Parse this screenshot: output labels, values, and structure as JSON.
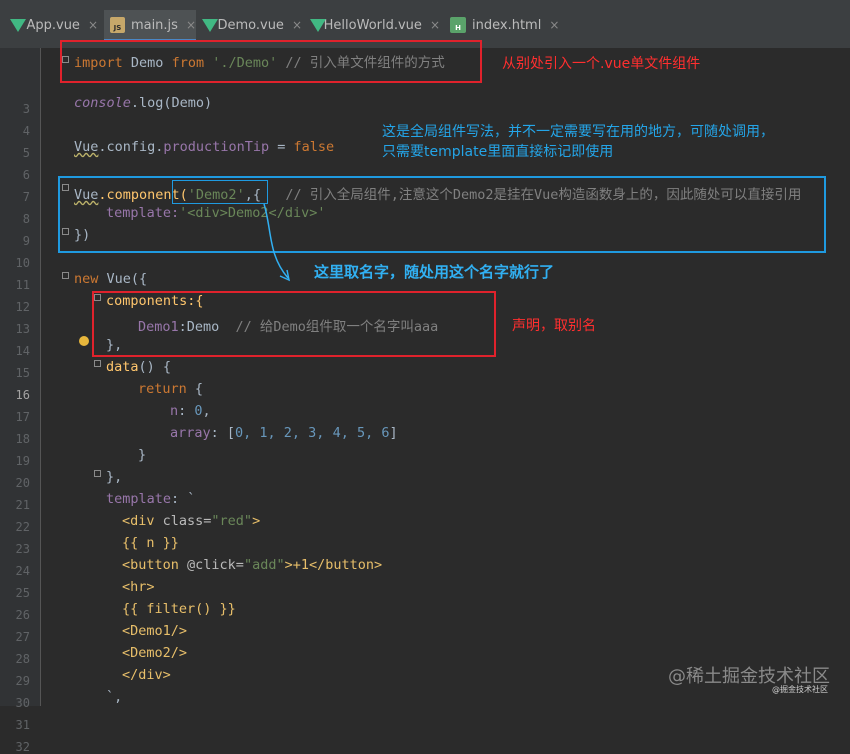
{
  "tabs": [
    {
      "label": "App.vue",
      "icon": "vue-icon",
      "active": false
    },
    {
      "label": "main.js",
      "icon": "js-file-icon",
      "active": true
    },
    {
      "label": "Demo.vue",
      "icon": "vue-icon",
      "active": false
    },
    {
      "label": "HelloWorld.vue",
      "icon": "vue-icon",
      "active": false
    },
    {
      "label": "index.html",
      "icon": "html-file-icon",
      "active": false
    }
  ],
  "tab_close_glyph": "×",
  "js_badge": "JS",
  "html_badge": "H",
  "line_numbers": [
    "3",
    "4",
    "5",
    "6",
    "7",
    "8",
    "9",
    "10",
    "11",
    "12",
    "13",
    "14",
    "15",
    "16",
    "17",
    "18",
    "19",
    "20",
    "21",
    "22",
    "23",
    "24",
    "25",
    "26",
    "27",
    "28",
    "29",
    "30",
    "31",
    "32"
  ],
  "current_line": "16",
  "code": {
    "l3_import": "import",
    "l3_demo": " Demo ",
    "l3_from": "from",
    "l3_path": " './Demo'",
    "l3_comment": " // 引入单文件组件的方式",
    "l5_console": "console",
    "l5_rest": ".log(Demo)",
    "l7_vue": "Vue",
    "l7_config": ".config.",
    "l7_tip": "productionTip",
    "l7_eq": " = ",
    "l7_false": "false",
    "l9_vue": "Vue",
    "l9_component": ".component(",
    "l9_name": "'Demo2'",
    "l9_rest": ",{",
    "l9_comment": "   // 引入全局组件,注意这个Demo2是挂在Vue构造函数身上的，因此随处可以直接引用",
    "l10_template": "template:",
    "l10_str": "'<div>Demo2</div>'",
    "l11": "})",
    "l13_new": "new",
    "l13_rest": " Vue({",
    "l14": "components:{",
    "l15_key": "Demo1",
    "l15_rest": ":Demo",
    "l15_comment": "  // 给Demo组件取一个名字叫aaa",
    "l16": "},",
    "l17_data": "data",
    "l17_rest": "() {",
    "l18_return": "return",
    "l18_rest": " {",
    "l19_n": "n",
    "l19_colon": ": ",
    "l19_val": "0",
    "l19_comma": ",",
    "l20_array": "array",
    "l20_colon": ": [",
    "l20_values": "0, 1, 2, 3, 4, 5, 6",
    "l20_close": "]",
    "l21": "}",
    "l22": "},",
    "l23_template": "template",
    "l23_rest": ": `",
    "l24_open": "<div ",
    "l24_attr": "class=",
    "l24_val": "\"red\"",
    "l24_close": ">",
    "l25": "{{ n }}",
    "l26_open": "<button ",
    "l26_attr": "@click=",
    "l26_val": "\"add\"",
    "l26_close": ">+1</button>",
    "l27": "<hr>",
    "l28": "{{ filter() }}",
    "l29": "<Demo1/>",
    "l30": "<Demo2/>",
    "l31": "</div>",
    "l32": "`,"
  },
  "annotations": {
    "import_note": "从别处引入一个.vue单文件组件",
    "global_note_1": "这是全局组件写法，并不一定需要写在用的地方，可随处调用，",
    "global_note_2": "只需要template里面直接标记即使用",
    "name_note": "这里取名字，随处用这个名字就行了",
    "declare_note": "声明，取别名"
  },
  "watermark": {
    "main": "@稀土掘金技术社区",
    "small": "@掘金技术社区"
  },
  "colors": {
    "background": "#2b2b2b",
    "keyword": "#cc7832",
    "string": "#6a8759",
    "number": "#6897bb",
    "comment": "#808080",
    "red_box": "#e0222c",
    "blue_box": "#1f9ae0"
  }
}
